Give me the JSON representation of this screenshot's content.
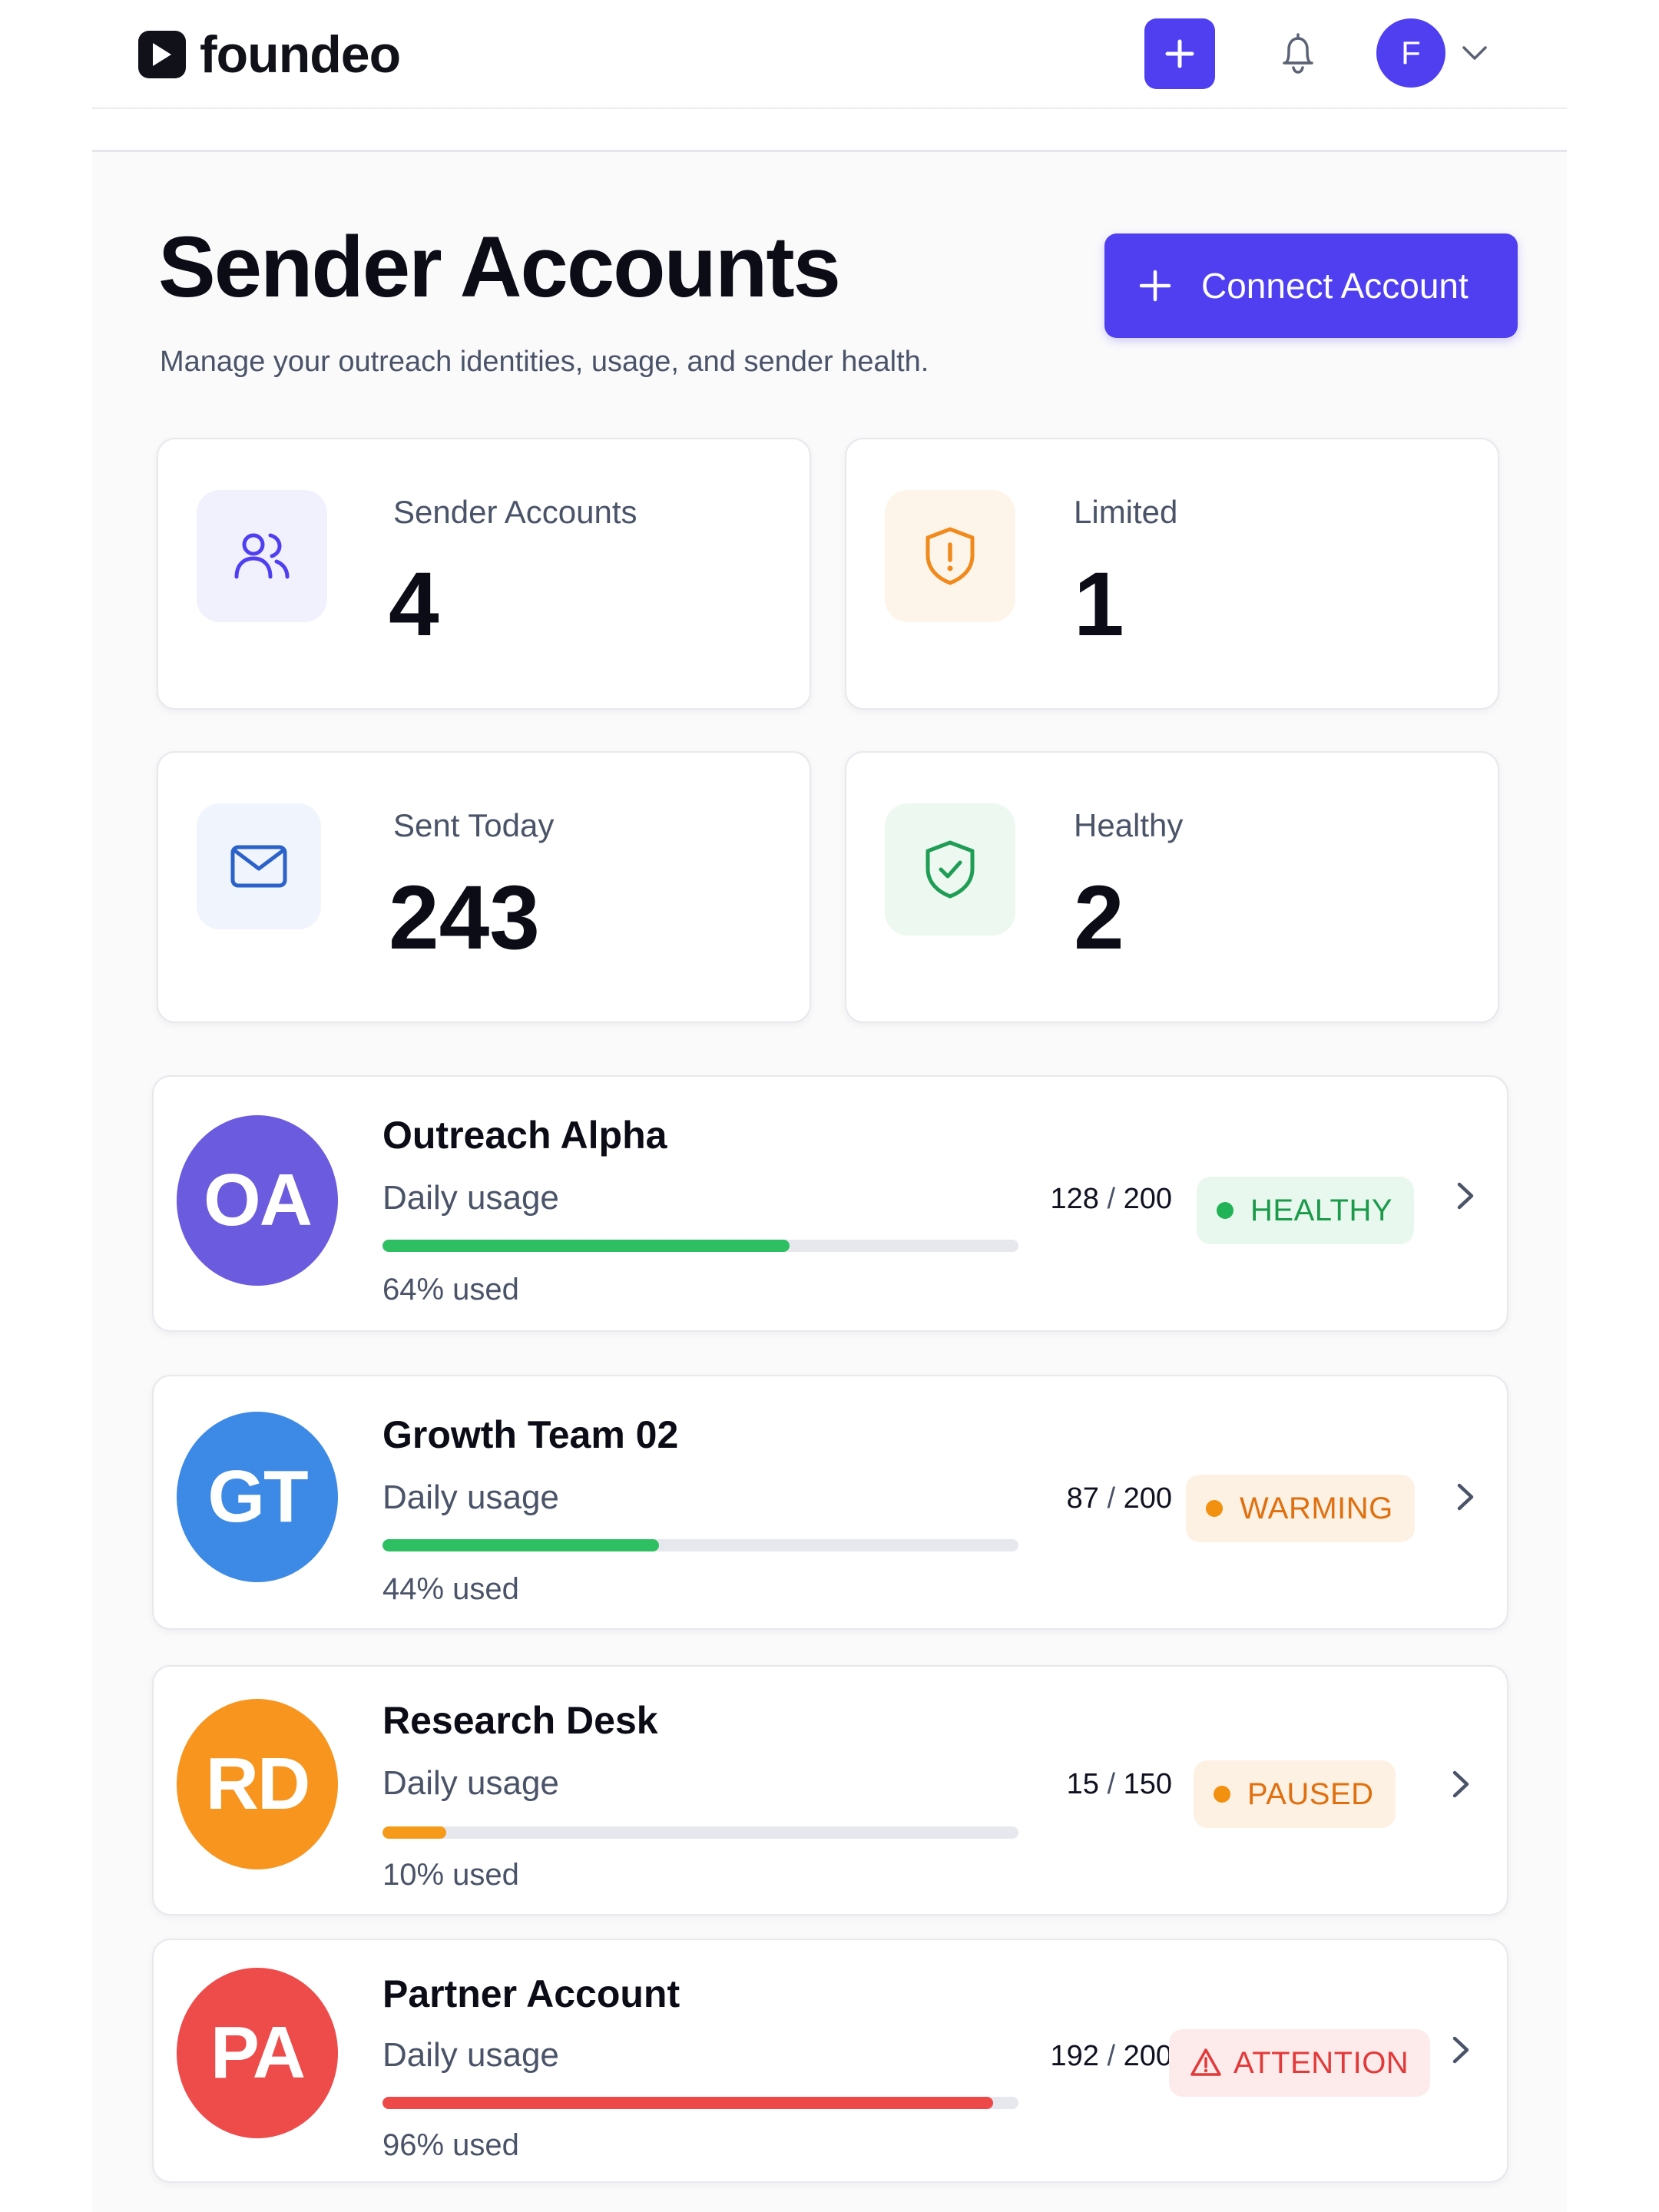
{
  "header": {
    "logo_text": "foundeo",
    "avatar_initial": "F"
  },
  "page": {
    "title": "Sender Accounts",
    "subtitle": "Manage your outreach identities, usage, and sender health.",
    "connect_label": "Connect Account"
  },
  "stats": [
    {
      "label": "Sender Accounts",
      "value": "4",
      "icon": "users-icon",
      "color": "#4f3ff0",
      "bg": "#f1f0fd"
    },
    {
      "label": "Limited",
      "value": "1",
      "icon": "shield-alert-icon",
      "color": "#f08a1c",
      "bg": "#fef5ea"
    },
    {
      "label": "Sent Today",
      "value": "243",
      "icon": "mail-icon",
      "color": "#2b62c9",
      "bg": "#eff4fd"
    },
    {
      "label": "Healthy",
      "value": "2",
      "icon": "shield-check-icon",
      "color": "#1f9d55",
      "bg": "#edf8f0"
    }
  ],
  "accounts": [
    {
      "initials": "OA",
      "name": "Outreach Alpha",
      "usage_label": "Daily usage",
      "used": "128",
      "limit": "200",
      "fraction": 0.64,
      "pct_text": "64% used",
      "status": "HEALTHY",
      "status_kind": "dot",
      "avatar_color": "#6b5bde",
      "bar_color": "#2fbf63",
      "badge_text_color": "#1a9a4a",
      "badge_bg": "#e9f8ee",
      "dot_color": "#21b356"
    },
    {
      "initials": "GT",
      "name": "Growth Team 02",
      "usage_label": "Daily usage",
      "used": "87",
      "limit": "200",
      "fraction": 0.435,
      "pct_text": "44% used",
      "status": "WARMING",
      "status_kind": "dot",
      "avatar_color": "#3d8ae6",
      "bar_color": "#2fbf63",
      "badge_text_color": "#e0700f",
      "badge_bg": "#fdf1e3",
      "dot_color": "#f2900f"
    },
    {
      "initials": "RD",
      "name": "Research Desk",
      "usage_label": "Daily usage",
      "used": "15",
      "limit": "150",
      "fraction": 0.1,
      "pct_text": "10% used",
      "status": "PAUSED",
      "status_kind": "dot",
      "avatar_color": "#f7951f",
      "bar_color": "#f59b19",
      "badge_text_color": "#e0700f",
      "badge_bg": "#fdf1e3",
      "dot_color": "#f2900f"
    },
    {
      "initials": "PA",
      "name": "Partner Account",
      "usage_label": "Daily usage",
      "used": "192",
      "limit": "200",
      "fraction": 0.96,
      "pct_text": "96% used",
      "status": "ATTENTION",
      "status_kind": "warning",
      "avatar_color": "#ee4b4b",
      "bar_color": "#ef4848",
      "badge_text_color": "#e23a3a",
      "badge_bg": "#fdeaea",
      "dot_color": "#e23a3a"
    }
  ]
}
